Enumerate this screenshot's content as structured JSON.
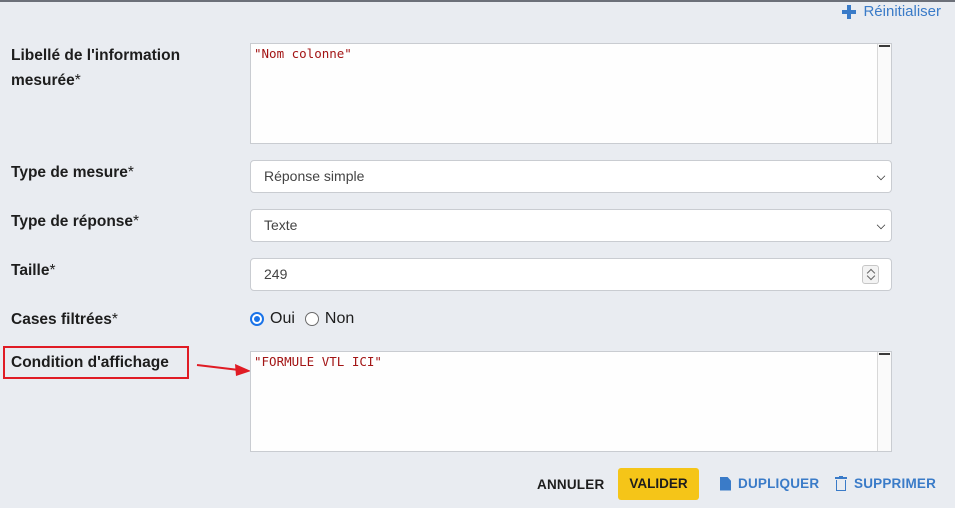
{
  "header": {
    "reset_label": "Réinitialiser"
  },
  "form": {
    "label_field": {
      "label_line1": "Libellé de l'information",
      "label_line2": "mesurée",
      "required_mark": "*",
      "value": "\"Nom colonne\""
    },
    "measure_type": {
      "label": "Type de mesure",
      "required_mark": "*",
      "value": "Réponse simple"
    },
    "response_type": {
      "label": "Type de réponse",
      "required_mark": "*",
      "value": "Texte"
    },
    "size": {
      "label": "Taille",
      "required_mark": "*",
      "value": "249"
    },
    "filtered_cells": {
      "label": "Cases filtrées",
      "required_mark": "*",
      "options": [
        {
          "label": "Oui",
          "selected": true
        },
        {
          "label": "Non",
          "selected": false
        }
      ]
    },
    "display_condition": {
      "label": "Condition d'affichage",
      "value": "\"FORMULE VTL ICI\""
    }
  },
  "footer": {
    "cancel_label": "ANNULER",
    "validate_label": "VALIDER",
    "duplicate_label": "DUPLIQUER",
    "delete_label": "SUPPRIMER"
  },
  "colors": {
    "accent": "#3a7bc8",
    "validate_bg": "#f5c518",
    "highlight": "#e01b24",
    "code_text": "#a31515"
  }
}
